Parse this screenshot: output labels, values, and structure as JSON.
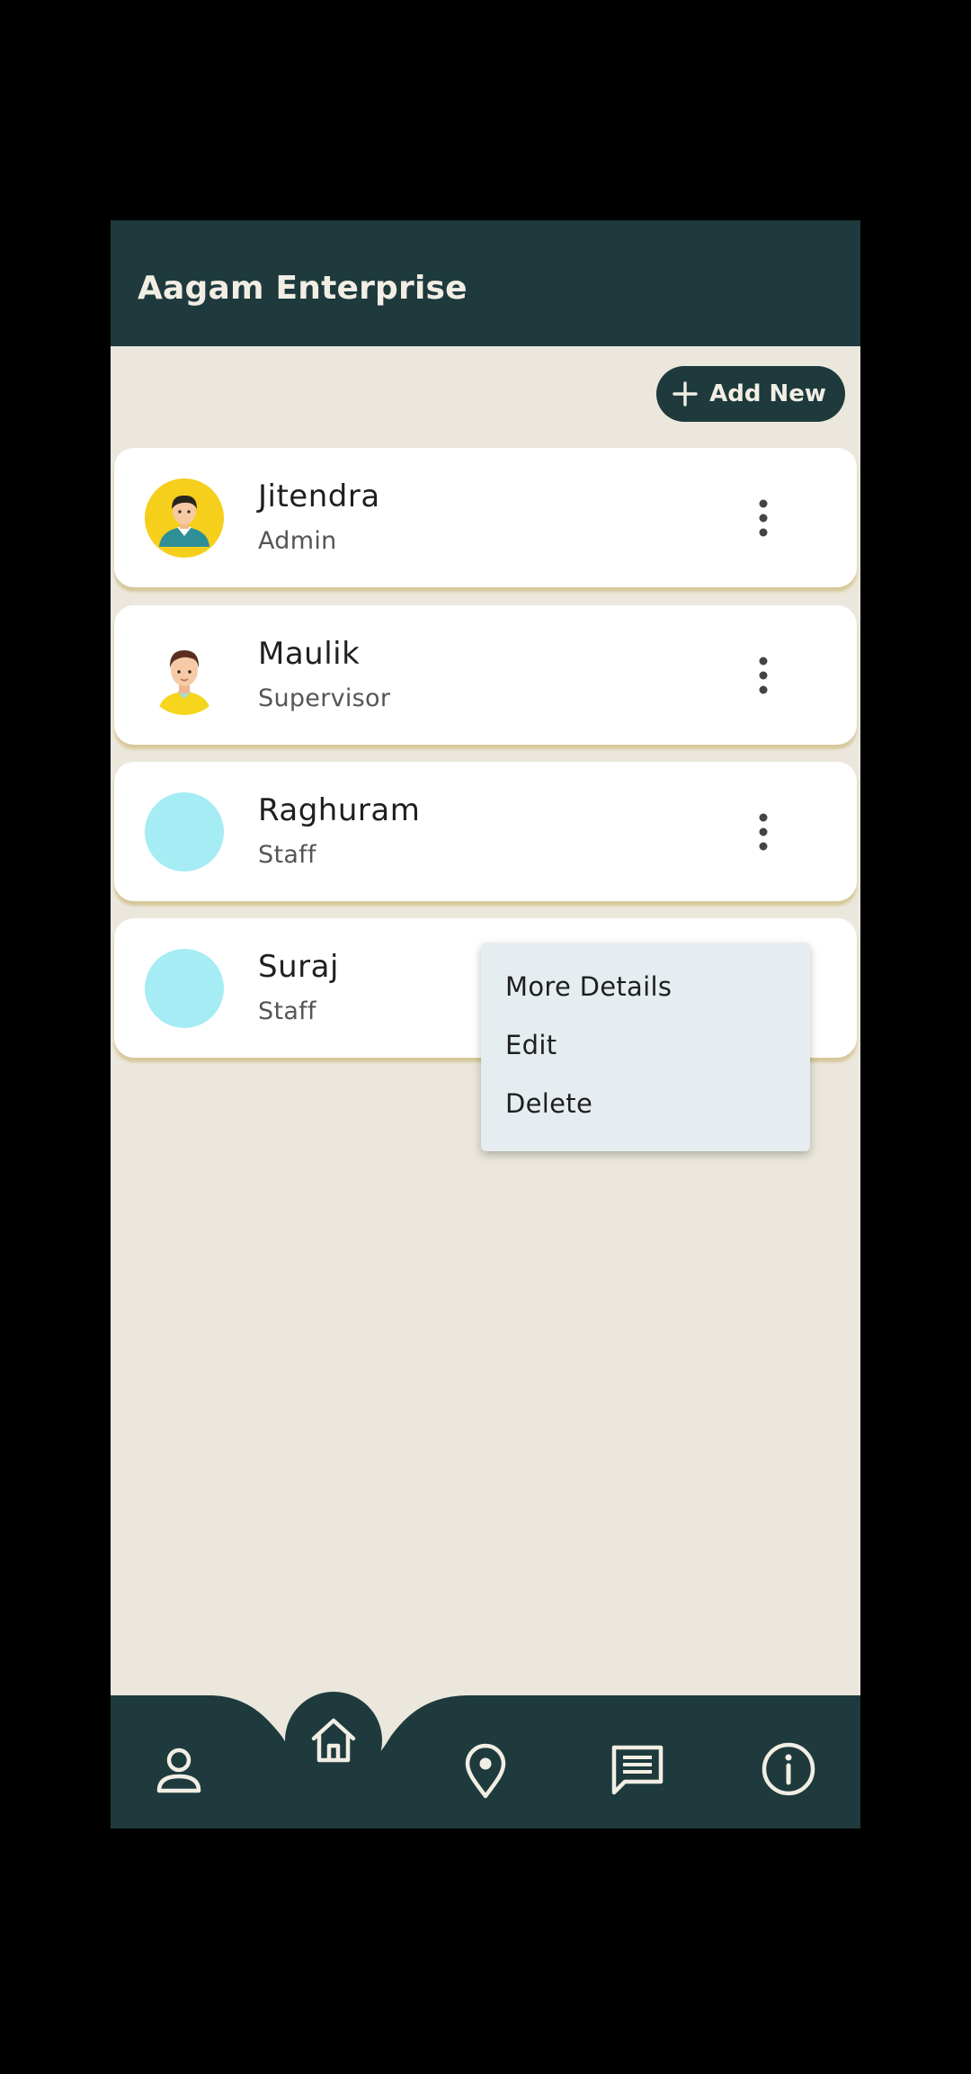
{
  "app": {
    "title": "Aagam Enterprise"
  },
  "actions": {
    "add_new_label": "Add New"
  },
  "users": [
    {
      "name": "Jitendra",
      "role": "Admin",
      "avatar": "man-avatar-yellow-icon"
    },
    {
      "name": "Maulik",
      "role": "Supervisor",
      "avatar": "man-avatar-icon"
    },
    {
      "name": "Raghuram",
      "role": "Staff",
      "avatar": "placeholder-avatar"
    },
    {
      "name": "Suraj",
      "role": "Staff",
      "avatar": "placeholder-avatar"
    }
  ],
  "context_menu": {
    "items": [
      "More Details",
      "Edit",
      "Delete"
    ]
  },
  "bottom_nav": {
    "items": [
      "person-icon",
      "home-icon",
      "location-pin-icon",
      "chat-icon",
      "info-icon"
    ],
    "active": "home-icon"
  },
  "colors": {
    "primary": "#1e3a3d",
    "background": "#ebe7dc",
    "on_primary": "#f2eee4",
    "avatar_placeholder": "#a6ecf4",
    "menu_background": "#e6edf0"
  }
}
